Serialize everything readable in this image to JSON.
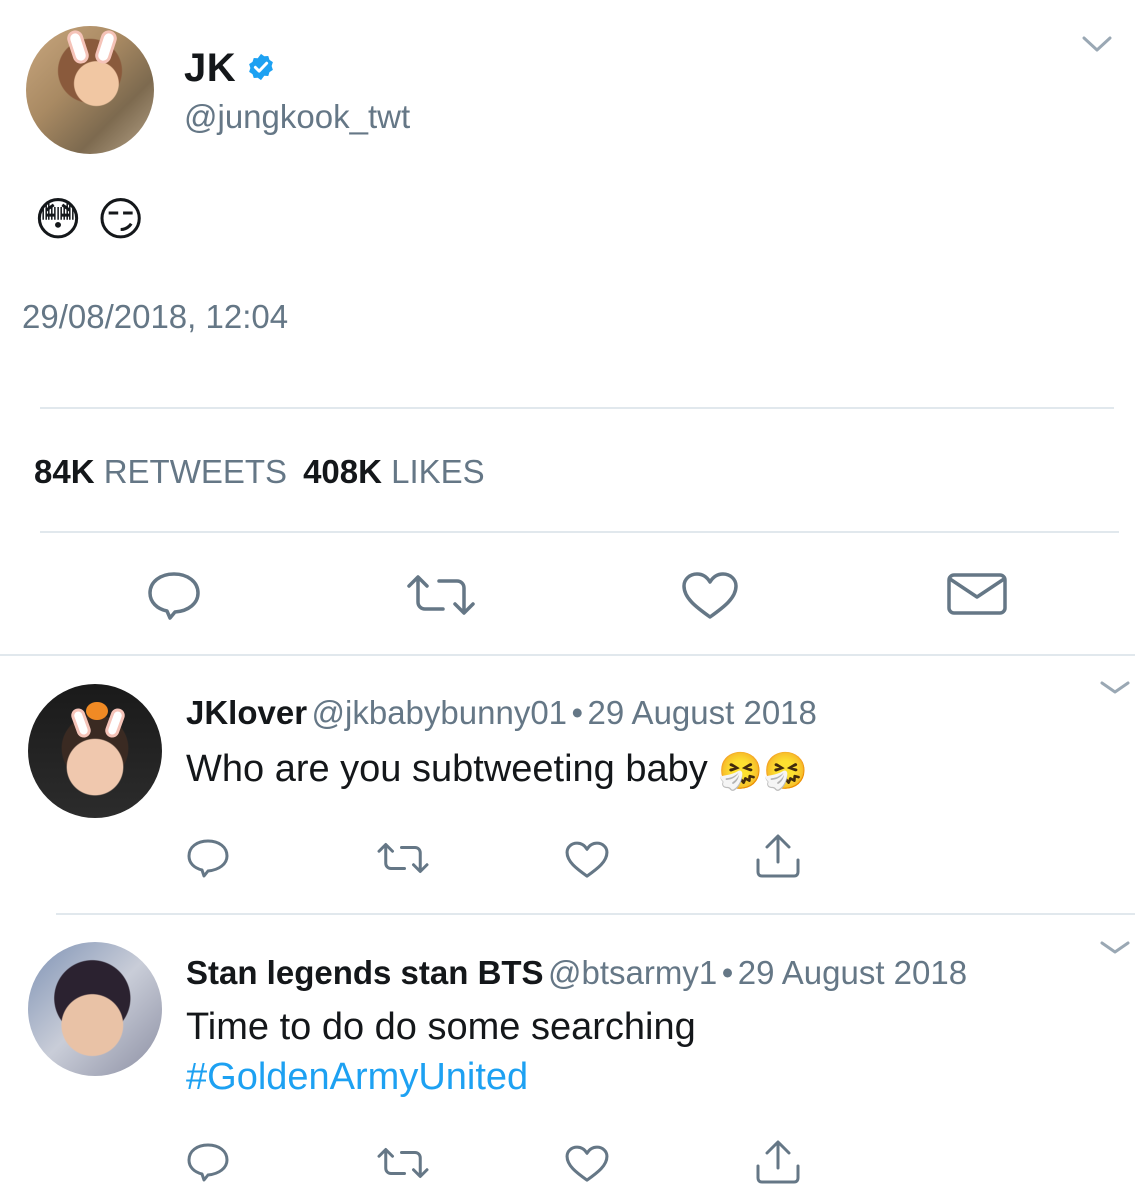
{
  "main_tweet": {
    "name": "JK",
    "handle": "@jungkook_twt",
    "text": "😳 😏",
    "timestamp": "29/08/2018, 12:04",
    "retweets_count": "84K",
    "retweets_label": "RETWEETS",
    "likes_count": "408K",
    "likes_label": "LIKES",
    "verified": true
  },
  "replies": [
    {
      "name": "JKlover",
      "handle": "@jkbabybunny01",
      "separator": "•",
      "date": "29 August 2018",
      "text": "Who are you subtweeting baby",
      "emoji": "🤧🤧"
    },
    {
      "name": "Stan legends stan BTS",
      "handle": "@btsarmy1",
      "separator": "•",
      "date": "29 August 2018",
      "text": "Time to do do some searching",
      "hashtag": "#GoldenArmyUnited"
    }
  ],
  "icons": {
    "reply": "reply-icon",
    "retweet": "retweet-icon",
    "like": "heart-icon",
    "dm": "mail-icon",
    "share": "share-icon",
    "caret": "chevron-down-icon",
    "verified": "verified-badge-icon"
  },
  "colors": {
    "text": "#14171a",
    "secondary": "#657786",
    "link": "#1da1f2",
    "divider": "#e1e8ed",
    "icon": "#657786",
    "verified": "#1da1f2"
  }
}
